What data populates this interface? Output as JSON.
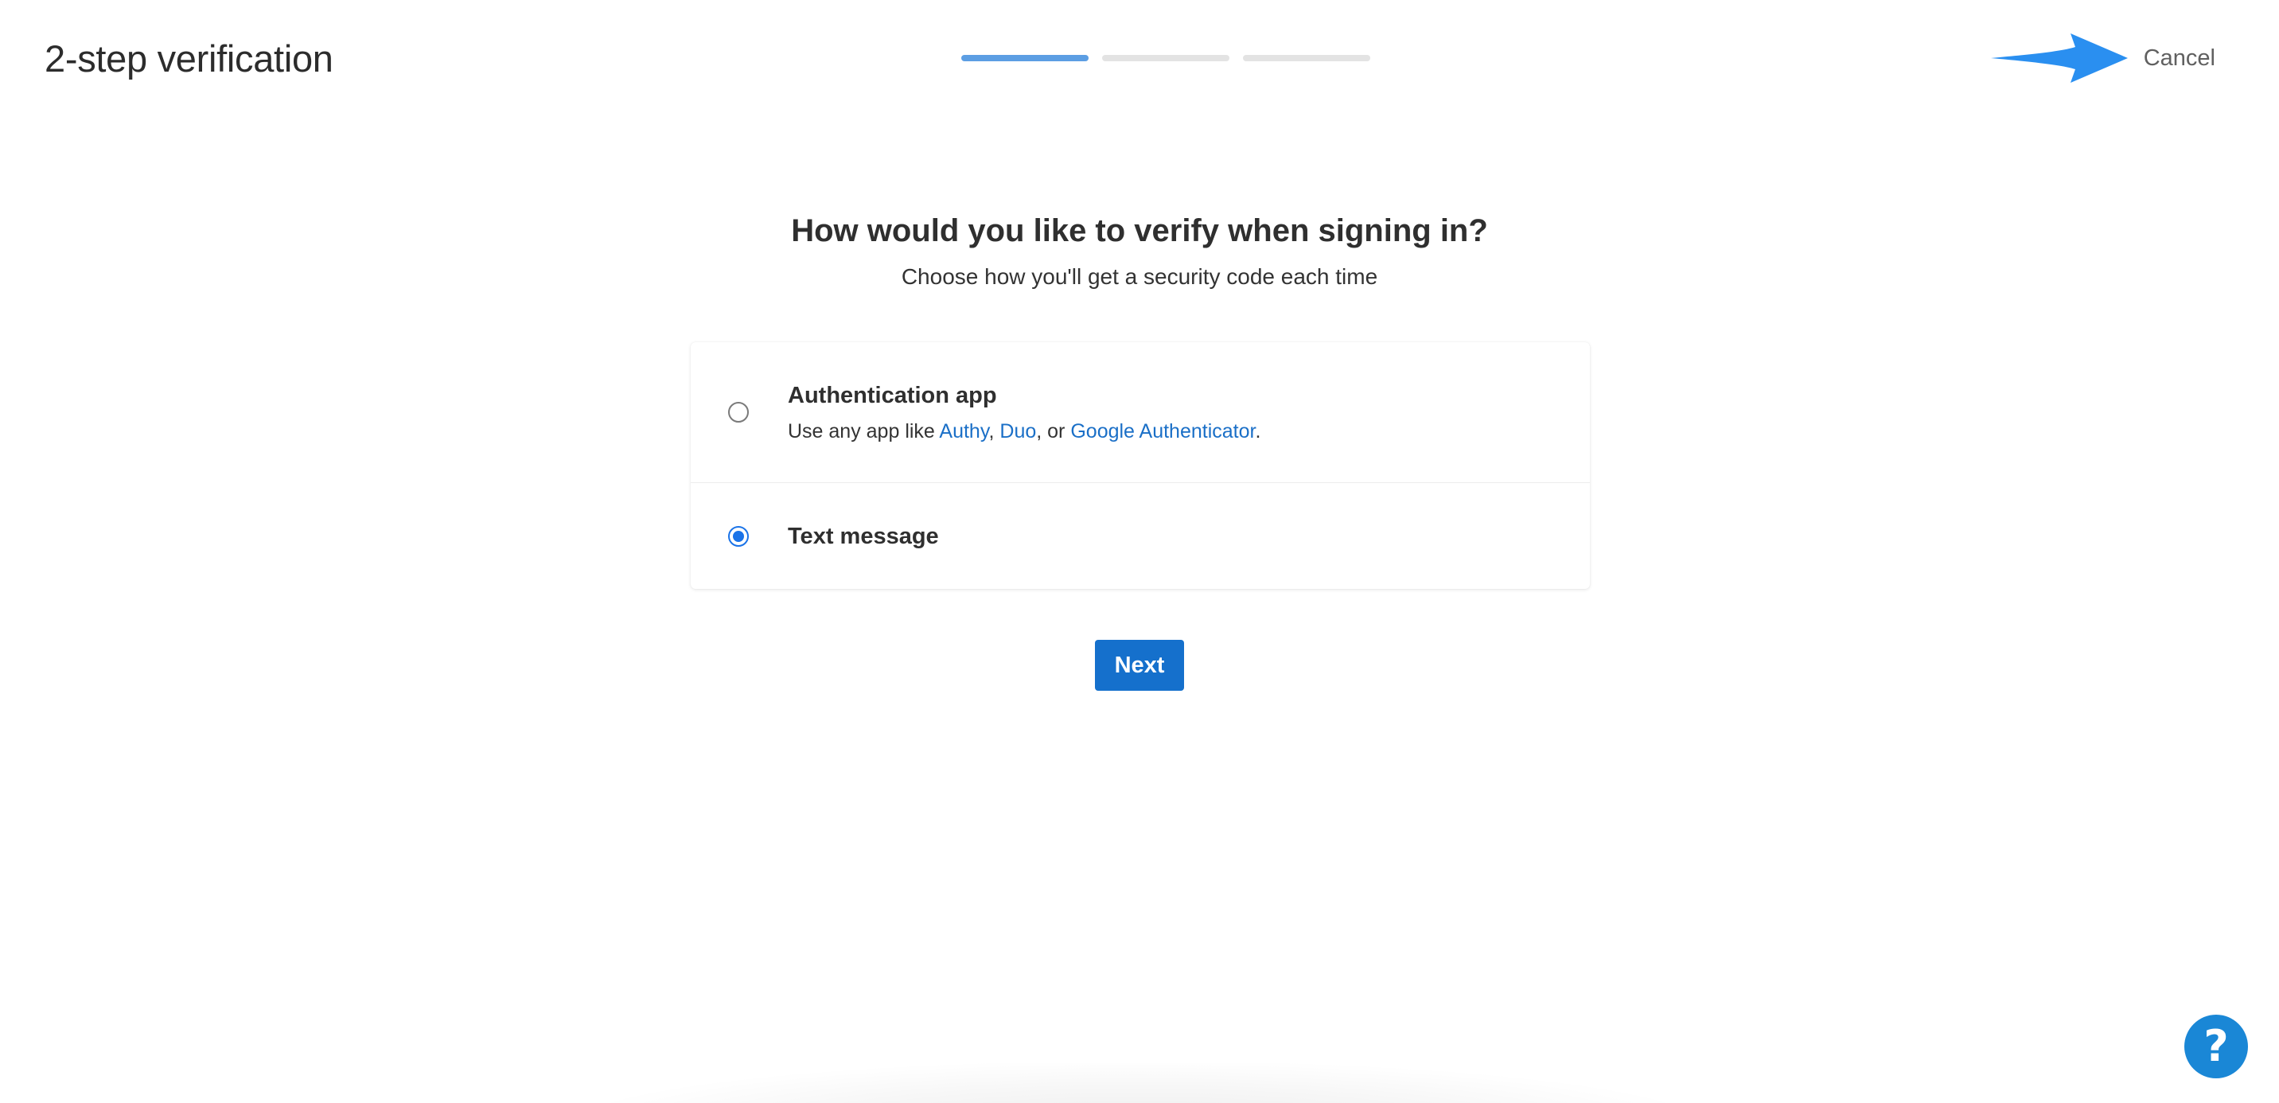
{
  "header": {
    "title": "2-step verification",
    "progress": {
      "total_steps": 3,
      "current_step": 1
    },
    "cancel_label": "Cancel",
    "arrow_color": "#2a8ff0"
  },
  "main": {
    "heading": "How would you like to verify when signing in?",
    "subheading": "Choose how you'll get a security code each time",
    "options": [
      {
        "title": "Authentication app",
        "selected": false,
        "desc_prefix": "Use any app like ",
        "links": [
          "Authy",
          "Duo",
          "Google Authenticator"
        ],
        "sep1": ", ",
        "sep2": ", or ",
        "desc_suffix": "."
      },
      {
        "title": "Text message",
        "selected": true
      }
    ],
    "next_label": "Next"
  },
  "help": {
    "label": "?"
  },
  "colors": {
    "accent": "#1570cc",
    "link": "#1a6fc7",
    "progress_active": "#5c9ee3",
    "progress_inactive": "#e3e3e3",
    "help": "#1a87d6"
  }
}
